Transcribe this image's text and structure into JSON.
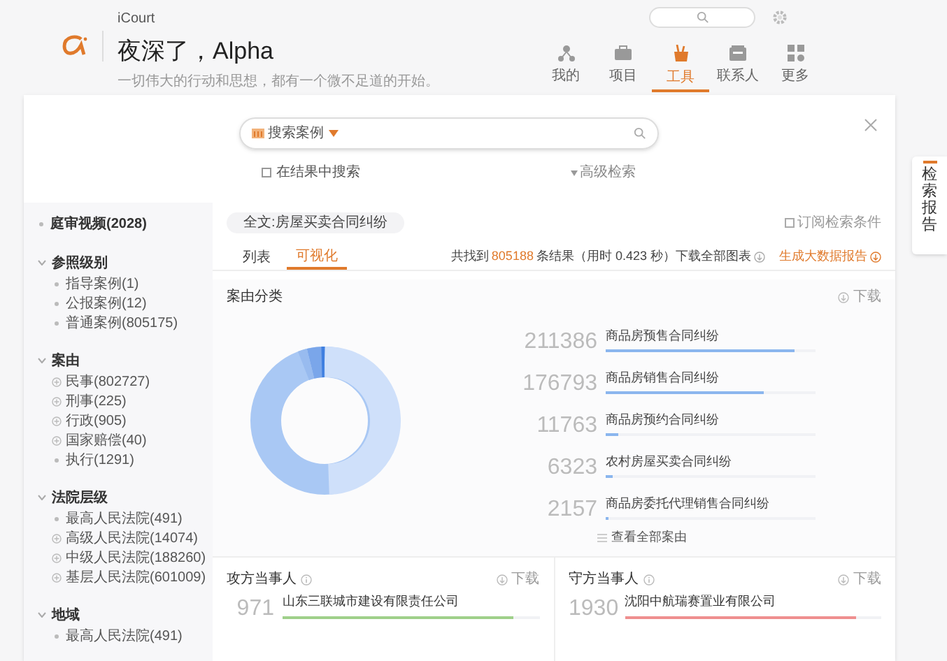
{
  "header": {
    "app_name": "iCourt",
    "greeting": "夜深了，Alpha",
    "motto": "一切伟大的行动和思想，都有一个微不足道的开始。",
    "nav": [
      {
        "label": "我的",
        "selected": false
      },
      {
        "label": "项目",
        "selected": false
      },
      {
        "label": "工具",
        "selected": true
      },
      {
        "label": "联系人",
        "selected": false
      },
      {
        "label": "更多",
        "selected": false
      }
    ]
  },
  "search": {
    "scope": "搜索案例",
    "search_within": {
      "label": "在结果中搜索",
      "checked": false
    },
    "advanced": "高级检索"
  },
  "side_tab": "检索报告",
  "sidebar": [
    {
      "label": "庭审视频(2028)"
    },
    {
      "label": "参照级别",
      "expanded": true,
      "children": [
        {
          "label": "指导案例(1)",
          "expandable": false
        },
        {
          "label": "公报案例(12)",
          "expandable": false
        },
        {
          "label": "普通案例(805175)",
          "expandable": false
        }
      ]
    },
    {
      "label": "案由",
      "expanded": true,
      "children": [
        {
          "label": "民事(802727)",
          "expandable": true
        },
        {
          "label": "刑事(225)",
          "expandable": true
        },
        {
          "label": "行政(905)",
          "expandable": true
        },
        {
          "label": "国家赔偿(40)",
          "expandable": true
        },
        {
          "label": "执行(1291)",
          "expandable": false
        }
      ]
    },
    {
      "label": "法院层级",
      "expanded": true,
      "children": [
        {
          "label": "最高人民法院(491)",
          "expandable": false
        },
        {
          "label": "高级人民法院(14074)",
          "expandable": true
        },
        {
          "label": "中级人民法院(188260)",
          "expandable": true
        },
        {
          "label": "基层人民法院(601009)",
          "expandable": true
        }
      ]
    },
    {
      "label": "地域",
      "expanded": true,
      "children": [
        {
          "label": "最高人民法院(491)",
          "expandable": false
        }
      ]
    }
  ],
  "filter_chip": "全文:房屋买卖合同纠纷",
  "subscribe": {
    "label": "订阅检索条件",
    "checked": false
  },
  "view_tabs": [
    {
      "label": "列表",
      "selected": false
    },
    {
      "label": "可视化",
      "selected": true
    }
  ],
  "summary": {
    "prefix": "共找到",
    "count": "805188",
    "suffix": "条结果（用时 0.423 秒）下载全部图表",
    "report": "生成大数据报告"
  },
  "cause_panel": {
    "title": "案由分类",
    "download": "下载",
    "more": "查看全部案由",
    "items": [
      {
        "count": "211386",
        "label": "商品房预售合同纠纷",
        "level": 0.9
      },
      {
        "count": "176793",
        "label": "商品房销售合同纠纷",
        "level": 0.75
      },
      {
        "count": "11763",
        "label": "商品房预约合同纠纷",
        "level": 0.06
      },
      {
        "count": "6323",
        "label": "农村房屋买卖合同纠纷",
        "level": 0.03
      },
      {
        "count": "2157",
        "label": "商品房委托代理销售合同纠纷",
        "level": 0.01
      }
    ]
  },
  "party_panels": [
    {
      "title": "攻方当事人",
      "download": "下载",
      "items": [
        {
          "count": "971",
          "label": "山东三联城市建设有限责任公司",
          "level": 0.9,
          "color": "#9fd08a"
        }
      ]
    },
    {
      "title": "守方当事人",
      "download": "下载",
      "items": [
        {
          "count": "1930",
          "label": "沈阳中航瑞赛置业有限公司",
          "level": 0.9,
          "color": "#ef8f8f"
        }
      ]
    }
  ]
}
